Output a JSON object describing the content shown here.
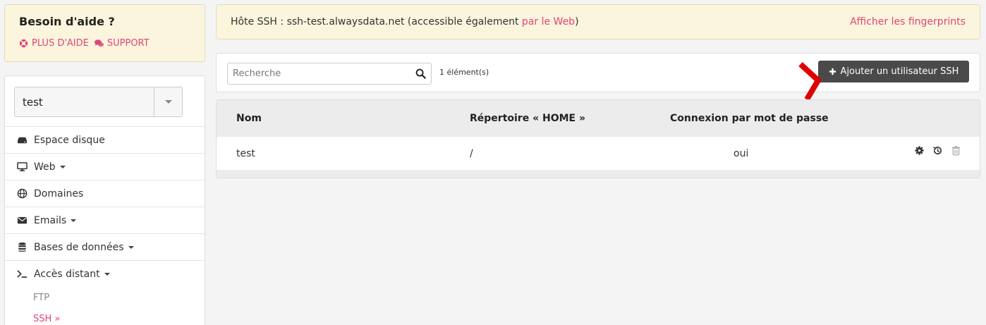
{
  "help": {
    "title": "Besoin d'aide ?",
    "more_help": "PLUS D'AIDE",
    "support": "SUPPORT"
  },
  "sidebar": {
    "account": "test",
    "items": [
      {
        "label": "Espace disque",
        "icon": "hdd-icon",
        "dropdown": false
      },
      {
        "label": "Web",
        "icon": "monitor-icon",
        "dropdown": true
      },
      {
        "label": "Domaines",
        "icon": "globe-icon",
        "dropdown": false
      },
      {
        "label": "Emails",
        "icon": "envelope-icon",
        "dropdown": true
      },
      {
        "label": "Bases de données",
        "icon": "database-icon",
        "dropdown": true
      },
      {
        "label": "Accès distant",
        "icon": "terminal-icon",
        "dropdown": true
      }
    ],
    "sub_items": [
      {
        "label": "FTP",
        "active": false
      },
      {
        "label": "SSH »",
        "active": true
      }
    ]
  },
  "ssh_host": {
    "prefix": "Hôte SSH : ssh-test.alwaysdata.net (accessible également ",
    "web_link": "par le Web",
    "suffix": ")",
    "fingerprints": "Afficher les fingerprints"
  },
  "toolbar": {
    "search_placeholder": "Recherche",
    "count": "1 élément(s)",
    "add_button": "Ajouter un utilisateur SSH"
  },
  "table": {
    "headers": [
      "Nom",
      "Répertoire « HOME »",
      "Connexion par mot de passe"
    ],
    "rows": [
      {
        "name": "test",
        "home": "/",
        "password_login": "oui"
      }
    ]
  },
  "colors": {
    "accent": "#e0457b",
    "notice_bg": "#faf5dc",
    "button_bg": "#4a4a4a",
    "arrow": "#e00000"
  }
}
